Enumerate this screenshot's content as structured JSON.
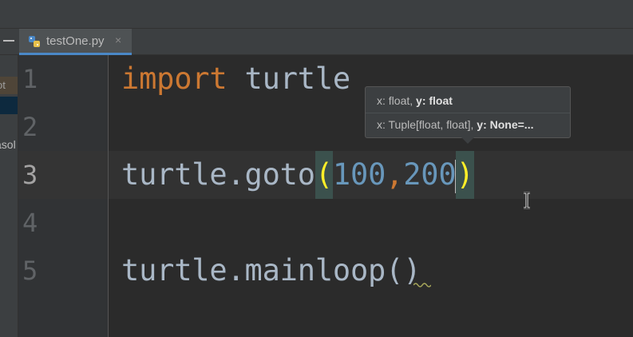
{
  "tab": {
    "file_name": "testOne.py",
    "close_glyph": "×",
    "icon": "python-file-icon"
  },
  "left_panel": {
    "hint_chip": "ot",
    "clipped_label": "asol"
  },
  "editor": {
    "lines": [
      {
        "number": "1"
      },
      {
        "number": "2"
      },
      {
        "number": "3"
      },
      {
        "number": "4"
      },
      {
        "number": "5"
      }
    ],
    "code": {
      "line1_keyword": "import",
      "line1_module": "turtle",
      "line3_call": "turtle.goto",
      "line3_open": "(",
      "line3_arg1": "100",
      "line3_comma": ",",
      "line3_arg2": "200",
      "line3_close": ")",
      "line5_call": "turtle.mainloop()"
    }
  },
  "param_info": {
    "row1_prefix": "x: float, ",
    "row1_bold": "y: float",
    "row2_prefix": "x: Tuple[float, float], ",
    "row2_bold": "y: None=..."
  },
  "colors": {
    "background": "#2b2b2b",
    "keyword": "#cc7832",
    "number": "#6897bb",
    "identifier": "#a9b7c6",
    "brace_highlight": "#ffef28",
    "tab_underline": "#4a88c7"
  }
}
